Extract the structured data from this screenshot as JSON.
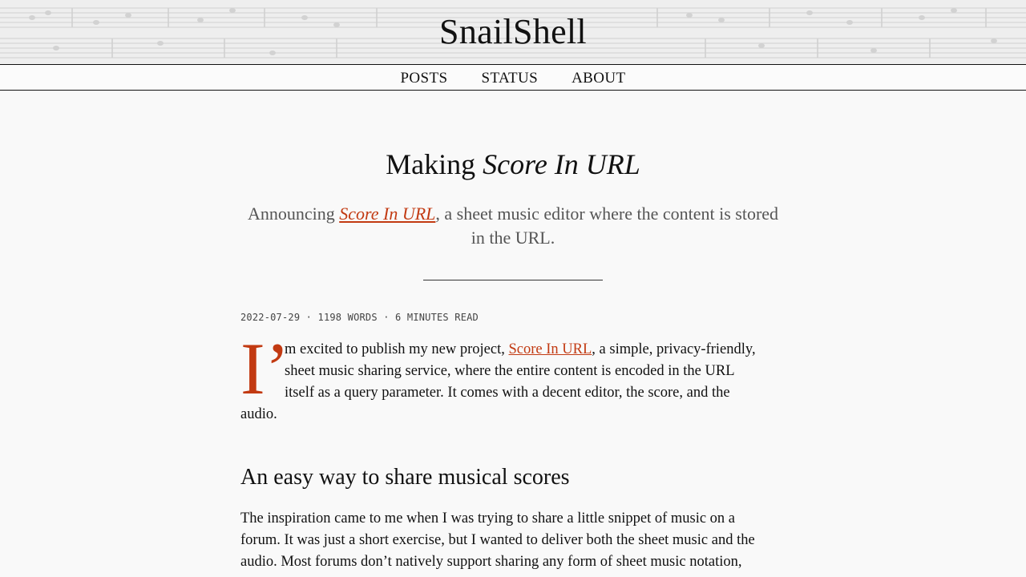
{
  "site": {
    "title": "SnailShell"
  },
  "nav": {
    "items": [
      "POSTS",
      "STATUS",
      "ABOUT"
    ]
  },
  "post": {
    "title_prefix": "Making",
    "title_em": "Score In URL",
    "subtitle_before": "Announcing",
    "subtitle_link": "Score In URL",
    "subtitle_after_line1": ", a sheet music editor where the content is stored",
    "subtitle_line2": "in the URL.",
    "meta": "2022-07-29 · 1198 WORDS · 6 MINUTES READ",
    "dropcap": "I’",
    "intro": {
      "line1_before": "m excited to publish my new project, ",
      "line1_link": "Score In URL",
      "line1_after": ", a simple, privacy-friendly,",
      "line2": "sheet music sharing service, where the entire content is encoded in the URL",
      "line3": "itself as a query parameter. It comes with a decent editor, the score, and the",
      "line4": "audio."
    },
    "section_heading": "An easy way to share musical scores",
    "para2": {
      "line1": "The inspiration came to me when I was trying to share a little snippet of music on a",
      "line2": "forum. It was just a short exercise, but I wanted to deliver both the sheet music and the",
      "line3": "audio. Most forums don’t natively support sharing any form of sheet music notation,"
    }
  },
  "colors": {
    "accent": "#c23a12",
    "text": "#111111",
    "muted": "#555555",
    "background": "#f9f9f9"
  }
}
